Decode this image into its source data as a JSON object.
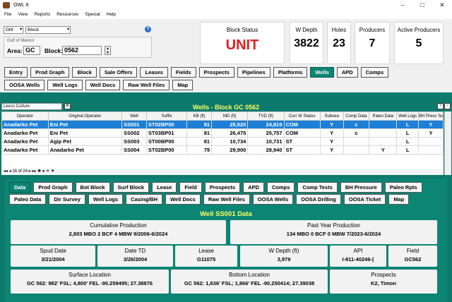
{
  "window": {
    "title": "OWL 8",
    "minimize": "–",
    "maximize": "□",
    "close": "✕"
  },
  "menu": [
    "File",
    "View",
    "Reports",
    "Resources",
    "Special",
    "Help"
  ],
  "selectors": {
    "region": "GM",
    "mode": "Block",
    "area_label": "Area:",
    "area_value": "GC",
    "block_label": "Block:",
    "block_value": "0562",
    "group": "Gulf of Mexico"
  },
  "stats": {
    "block_status_label": "Block Status",
    "block_status_value": "UNIT",
    "wdepth_label": "W Depth",
    "wdepth_value": "3822",
    "holes_label": "Holes",
    "holes_value": "23",
    "producers_label": "Producers",
    "producers_value": "7",
    "active_label": "Active Producers",
    "active_value": "5"
  },
  "nav_row1": [
    "Entry",
    "Prod Graph",
    "Block",
    "Sale Offers",
    "Leases",
    "Fields",
    "Prospects",
    "Pipelines",
    "Platforms",
    "Wells",
    "APD",
    "Comps"
  ],
  "nav_row2": [
    "OOSA Wells",
    "Well Logs",
    "Well Docs",
    "Raw Well Files",
    "Map"
  ],
  "nav_active": "Wells",
  "grid": {
    "culture": "Lexco Culture",
    "title": "Wells - Block GC 0562",
    "columns": [
      "Operator",
      "Original Operator",
      "Well",
      "Suffix",
      "KB (ft)",
      "MD (ft)",
      "TVD (ft)",
      "Curr W Status",
      "Subsea",
      "Comp Data",
      "Paleo Data",
      "Well Logs",
      "BH Press Surv"
    ],
    "rows": [
      [
        "Anadarko Pet",
        "Eni Pet",
        "SS001",
        "ST02BP00",
        "81",
        "25,520",
        "24,819",
        "COM",
        "Y",
        "c",
        "",
        "L",
        "Y"
      ],
      [
        "Anadarko Pet",
        "Eni Pet",
        "SS002",
        "ST03BP01",
        "81",
        "26,475",
        "25,757",
        "COM",
        "Y",
        "c",
        "",
        "L",
        "Y"
      ],
      [
        "Anadarko Pet",
        "Agip Pet",
        "SS003",
        "ST00BP00",
        "81",
        "10,734",
        "10,731",
        "ST",
        "Y",
        "",
        "",
        "L",
        ""
      ],
      [
        "Anadarko Pet",
        "Anadarko Pet",
        "SS004",
        "ST02BP00",
        "79",
        "29,900",
        "28,940",
        "ST",
        "Y",
        "",
        "Y",
        "L",
        ""
      ]
    ],
    "record_nav": "16 of 24"
  },
  "detail_row1": [
    "Data",
    "Prod Graph",
    "Bot Block",
    "Surf Block",
    "Lease",
    "Field",
    "Prospects",
    "APD",
    "Comps",
    "Comp Tests",
    "BH Pressure",
    "Paleo Rpts"
  ],
  "detail_row2": [
    "Paleo Data",
    "Dir Survey",
    "Well Logs",
    "Casing/BH",
    "Well Docs",
    "Raw Well Files",
    "OOSA Wells",
    "OOSA Drilling",
    "OOSA Ticket",
    "Map"
  ],
  "detail_active": "Data",
  "well": {
    "title": "Well SS001 Data",
    "cum_label": "Cumulative Production",
    "cum_value": "2,803 MBO   2 BCF   4 MBW   9/2006-6/2024",
    "past_label": "Past Year Production",
    "past_value": "134 MBO   0 BCF   0 MBW   7/2023-6/2024",
    "spud_label": "Spud Date",
    "spud_value": "3/21/2004",
    "td_label": "Date TD",
    "td_value": "3/26/2004",
    "lease_label": "Lease",
    "lease_value": "G11075",
    "wdepth_label": "W Depth (ft)",
    "wdepth_value": "3,979",
    "api_label": "API",
    "api_value": "I-811-40246-(",
    "field_label": "Field",
    "field_value": "GC562",
    "surf_label": "Surface Location",
    "surf_value": "GC 562: 982' FSL; 4,800' FEL   -90.259495;  27.38876",
    "bot_label": "Bottom Location",
    "bot_value": "GC 562: 1,636' FSL; 1,866' FEL   -90.250414;  27.39038",
    "prospects_label": "Prospects",
    "prospects_value": "K2, Timon"
  }
}
